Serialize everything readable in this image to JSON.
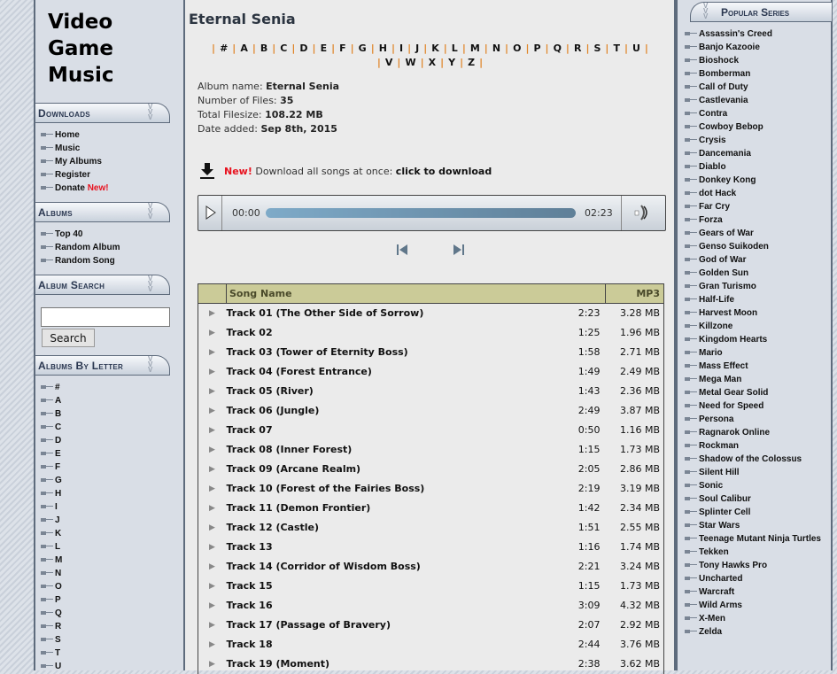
{
  "logo": "Video Game Music",
  "left": {
    "downloads_title": "Downloads",
    "downloads": [
      {
        "label": "Home"
      },
      {
        "label": "Music"
      },
      {
        "label": "My Albums"
      },
      {
        "label": "Register"
      },
      {
        "label": "Donate",
        "badge": "New!"
      }
    ],
    "albums_title": "Albums",
    "albums": [
      {
        "label": "Top 40"
      },
      {
        "label": "Random Album"
      },
      {
        "label": "Random Song"
      }
    ],
    "search_title": "Album Search",
    "search_value": "",
    "search_button": "Search",
    "letters_title": "Albums By Letter",
    "letters": [
      "#",
      "A",
      "B",
      "C",
      "D",
      "E",
      "F",
      "G",
      "H",
      "I",
      "J",
      "K",
      "L",
      "M",
      "N",
      "O",
      "P",
      "Q",
      "R",
      "S",
      "T",
      "U"
    ]
  },
  "main": {
    "title": "Eternal Senia",
    "letters": [
      "#",
      "A",
      "B",
      "C",
      "D",
      "E",
      "F",
      "G",
      "H",
      "I",
      "J",
      "K",
      "L",
      "M",
      "N",
      "O",
      "P",
      "Q",
      "R",
      "S",
      "T",
      "U",
      "V",
      "W",
      "X",
      "Y",
      "Z"
    ],
    "info": [
      {
        "label": "Album name: ",
        "value": "Eternal Senia"
      },
      {
        "label": "Number of Files: ",
        "value": "35"
      },
      {
        "label": "Total Filesize: ",
        "value": "108.22 MB"
      },
      {
        "label": "Date added: ",
        "value": "Sep 8th, 2015"
      }
    ],
    "download": {
      "badge": "New!",
      "text": " Download all songs at once: ",
      "link": "click to download"
    },
    "player": {
      "current": "00:00",
      "duration": "02:23",
      "progress": 0
    },
    "table": {
      "col_name": "Song Name",
      "col_format": "MP3",
      "rows": [
        [
          "Track 01 (The Other Side of Sorrow)",
          "2:23",
          "3.28 MB"
        ],
        [
          "Track 02",
          "1:25",
          "1.96 MB"
        ],
        [
          "Track 03 (Tower of Eternity Boss)",
          "1:58",
          "2.71 MB"
        ],
        [
          "Track 04 (Forest Entrance)",
          "1:49",
          "2.49 MB"
        ],
        [
          "Track 05 (River)",
          "1:43",
          "2.36 MB"
        ],
        [
          "Track 06 (Jungle)",
          "2:49",
          "3.87 MB"
        ],
        [
          "Track 07",
          "0:50",
          "1.16 MB"
        ],
        [
          "Track 08 (Inner Forest)",
          "1:15",
          "1.73 MB"
        ],
        [
          "Track 09 (Arcane Realm)",
          "2:05",
          "2.86 MB"
        ],
        [
          "Track 10 (Forest of the Fairies Boss)",
          "2:19",
          "3.19 MB"
        ],
        [
          "Track 11 (Demon Frontier)",
          "1:42",
          "2.34 MB"
        ],
        [
          "Track 12 (Castle)",
          "1:51",
          "2.55 MB"
        ],
        [
          "Track 13",
          "1:16",
          "1.74 MB"
        ],
        [
          "Track 14 (Corridor of Wisdom Boss)",
          "2:21",
          "3.24 MB"
        ],
        [
          "Track 15",
          "1:15",
          "1.73 MB"
        ],
        [
          "Track 16",
          "3:09",
          "4.32 MB"
        ],
        [
          "Track 17 (Passage of Bravery)",
          "2:07",
          "2.92 MB"
        ],
        [
          "Track 18",
          "2:44",
          "3.76 MB"
        ],
        [
          "Track 19 (Moment)",
          "2:38",
          "3.62 MB"
        ]
      ]
    }
  },
  "right": {
    "title": "Popular Series",
    "items": [
      "Assassin's Creed",
      "Banjo Kazooie",
      "Bioshock",
      "Bomberman",
      "Call of Duty",
      "Castlevania",
      "Contra",
      "Cowboy Bebop",
      "Crysis",
      "Dancemania",
      "Diablo",
      "Donkey Kong",
      "dot Hack",
      "Far Cry",
      "Forza",
      "Gears of War",
      "Genso Suikoden",
      "God of War",
      "Golden Sun",
      "Gran Turismo",
      "Half-Life",
      "Harvest Moon",
      "Killzone",
      "Kingdom Hearts",
      "Mario",
      "Mass Effect",
      "Mega Man",
      "Metal Gear Solid",
      "Need for Speed",
      "Persona",
      "Ragnarok Online",
      "Rockman",
      "Shadow of the Colossus",
      "Silent Hill",
      "Sonic",
      "Soul Calibur",
      "Splinter Cell",
      "Star Wars",
      "Teenage Mutant Ninja Turtles",
      "Tekken",
      "Tony Hawks Pro",
      "Uncharted",
      "Warcraft",
      "Wild Arms",
      "X-Men",
      "Zelda"
    ]
  }
}
